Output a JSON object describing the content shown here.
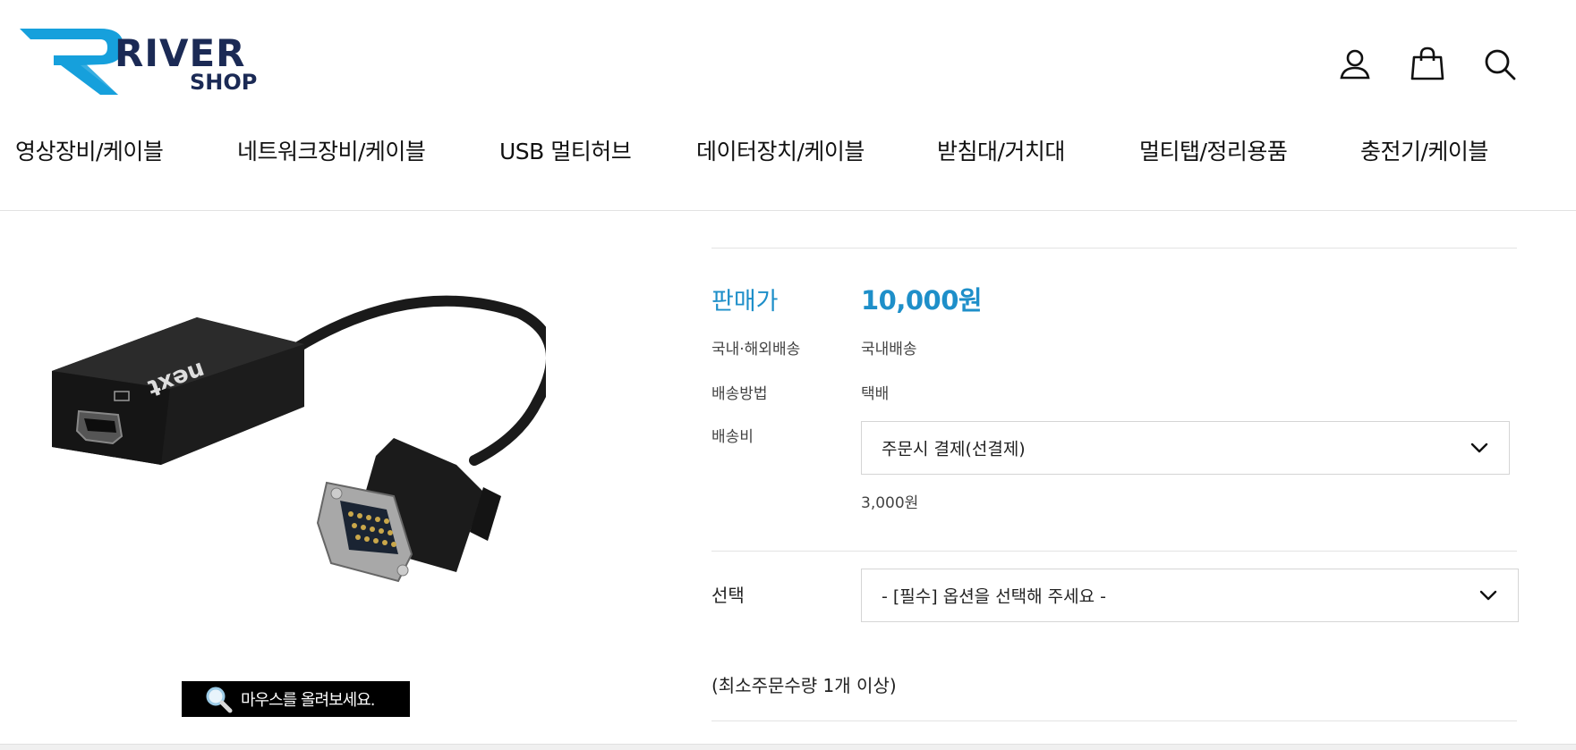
{
  "brand": {
    "logo_text_main": "RIVER",
    "logo_text_sub": "SHOP",
    "accent_color": "#16a0dc",
    "dark_color": "#1b2a55"
  },
  "header_icons": [
    "user-icon",
    "shopping-bag-icon",
    "search-icon"
  ],
  "nav": {
    "items": [
      "영상장비/케이블",
      "네트워크장비/케이블",
      "USB 멀티허브",
      "데이터장치/케이블",
      "받침대/거치대",
      "멀티탭/정리용품",
      "충전기/케이블"
    ]
  },
  "product": {
    "image_alt": "HDMI to VGA 변환 케이블",
    "image_brand_mark": "next",
    "zoom_hint": "마우스를 올려보세요."
  },
  "info": {
    "price_label": "판매가",
    "price_value": "10,000원",
    "price_color": "#1e8fc9",
    "shipping_region_label": "국내·해외배송",
    "shipping_region_value": "국내배송",
    "shipping_method_label": "배송방법",
    "shipping_method_value": "택배",
    "shipping_fee_label": "배송비",
    "shipping_fee_select": "주문시 결제(선결제)",
    "shipping_fee_amount": "3,000원",
    "option_label": "선택",
    "option_select_placeholder": "- [필수] 옵션을 선택해 주세요 -",
    "min_order_note": "(최소주문수량 1개 이상)"
  }
}
